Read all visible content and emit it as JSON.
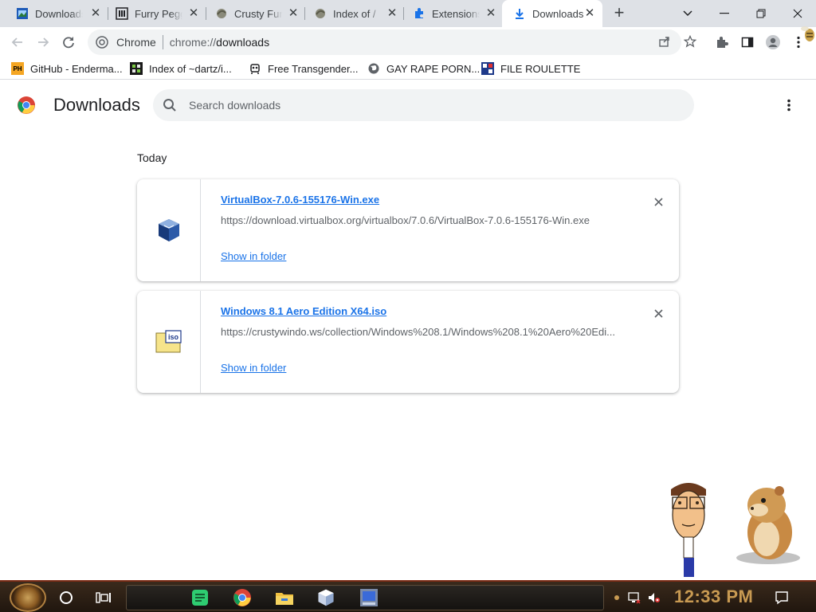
{
  "tabs": [
    {
      "title": "Downloads",
      "icon": "blue-window-icon"
    },
    {
      "title": "Furry Pegg",
      "icon": "museum-icon"
    },
    {
      "title": "Crusty Fur",
      "icon": "crusty-icon"
    },
    {
      "title": "Index of /",
      "icon": "crusty-icon"
    },
    {
      "title": "Extensions",
      "icon": "puzzle-icon"
    },
    {
      "title": "Downloads",
      "icon": "download-arrow-icon",
      "active": true
    }
  ],
  "omnibox": {
    "site_name": "Chrome",
    "url_scheme": "chrome://",
    "url_path": "downloads"
  },
  "bookmarks": [
    {
      "label": "GitHub - Enderma...",
      "icon_text": "PH"
    },
    {
      "label": "Index of ~dartz/i...",
      "icon_text": ""
    },
    {
      "label": "Free Transgender...",
      "icon_text": ""
    },
    {
      "label": "GAY RAPE PORN...",
      "icon_text": ""
    },
    {
      "label": "FILE ROULETTE",
      "icon_text": ""
    }
  ],
  "page": {
    "title": "Downloads",
    "search_placeholder": "Search downloads",
    "section_label": "Today"
  },
  "downloads": [
    {
      "file_name": "VirtualBox-7.0.6-155176-Win.exe",
      "url": "https://download.virtualbox.org/virtualbox/7.0.6/VirtualBox-7.0.6-155176-Win.exe",
      "action": "Show in folder",
      "icon": "virtualbox-icon"
    },
    {
      "file_name": "Windows 8.1 Aero Edition X64.iso",
      "url": "https://crustywindo.ws/collection/Windows%208.1/Windows%208.1%20Aero%20Edi...",
      "action": "Show in folder",
      "icon": "iso-file-icon"
    }
  ],
  "taskbar": {
    "clock": "12:33 PM"
  },
  "colors": {
    "link": "#1a73e8",
    "tabstrip": "#dee1e6",
    "clock": "#c89a52"
  }
}
